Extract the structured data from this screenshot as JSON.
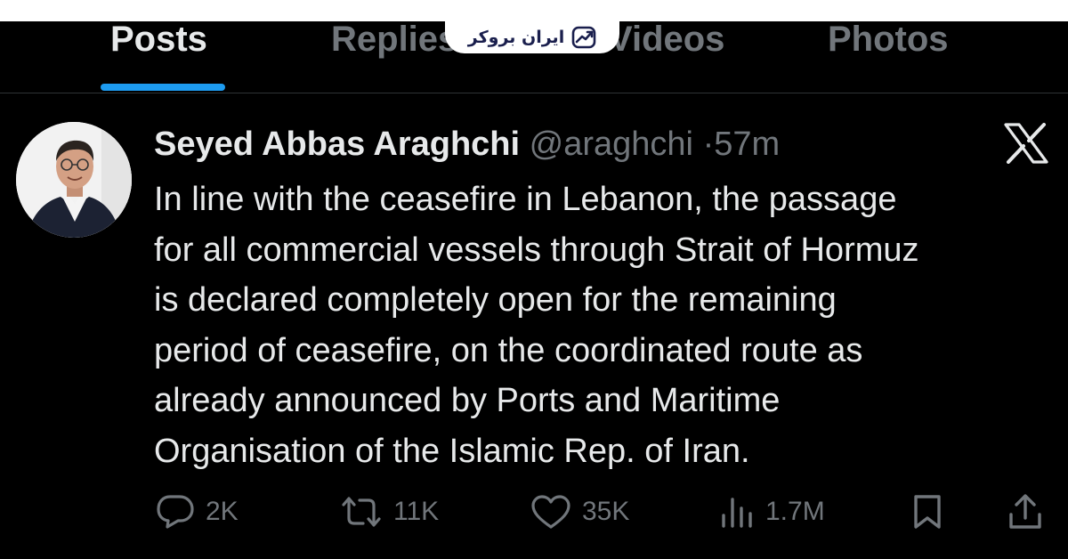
{
  "tabs": [
    {
      "label": "Posts",
      "active": true
    },
    {
      "label": "Replies",
      "active": false
    },
    {
      "label": "Videos",
      "active": false
    },
    {
      "label": "Photos",
      "active": false
    }
  ],
  "watermark": {
    "text": "ایران بروکر",
    "icon": "brand-chart-arrow-icon"
  },
  "tweet": {
    "author_name": "Seyed Abbas Araghchi",
    "handle": "@araghchi",
    "separator": "·",
    "time": "57m",
    "platform_icon": "x-logo-icon",
    "text_lines": [
      "In line with the ceasefire in Lebanon, the passage",
      "for all commercial vessels through Strait of Hormuz",
      "is declared completely open for the remaining",
      "period of ceasefire, on the coordinated route as",
      "already announced by Ports and Maritime",
      "Organisation of the Islamic Rep. of Iran."
    ]
  },
  "actions": {
    "reply": {
      "icon": "reply-icon",
      "count": "2K"
    },
    "repost": {
      "icon": "repost-icon",
      "count": "11K"
    },
    "like": {
      "icon": "heart-icon",
      "count": "35K"
    },
    "views": {
      "icon": "views-icon",
      "count": "1.7M"
    },
    "bookmark": {
      "icon": "bookmark-icon"
    },
    "share": {
      "icon": "share-icon"
    }
  },
  "colors": {
    "background": "#000000",
    "text_primary": "#e7e9ea",
    "text_secondary": "#71767b",
    "accent": "#1d9bf0",
    "watermark_bg": "#ffffff",
    "watermark_text": "#1a1f4d"
  }
}
